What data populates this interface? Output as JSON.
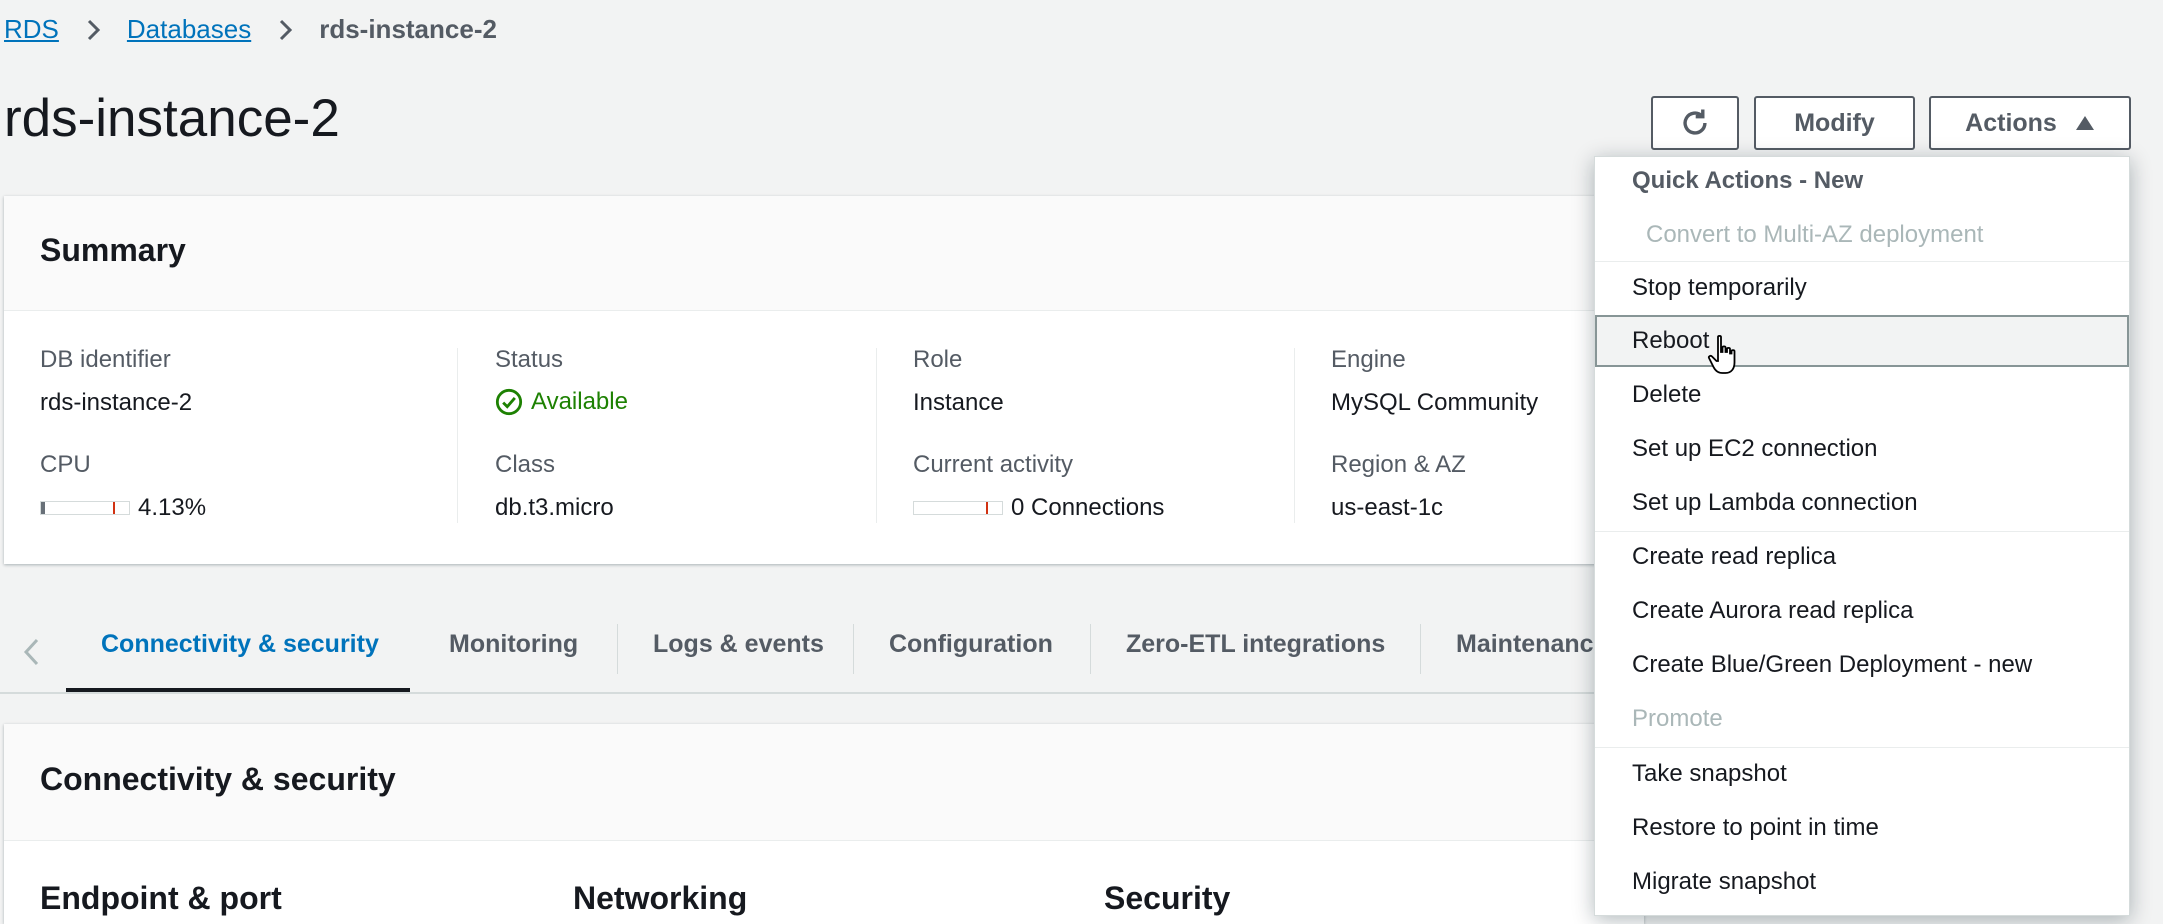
{
  "breadcrumb": {
    "items": [
      "RDS",
      "Databases"
    ],
    "current": "rds-instance-2"
  },
  "page": {
    "title": "rds-instance-2"
  },
  "header_buttons": {
    "refresh_icon": "refresh-icon",
    "modify": "Modify",
    "actions": "Actions"
  },
  "summary": {
    "title": "Summary",
    "db_identifier": {
      "label": "DB identifier",
      "value": "rds-instance-2"
    },
    "cpu": {
      "label": "CPU",
      "value": "4.13%",
      "fraction": 0.0413
    },
    "status": {
      "label": "Status",
      "value": "Available",
      "color": "#1d8102"
    },
    "class": {
      "label": "Class",
      "value": "db.t3.micro"
    },
    "role": {
      "label": "Role",
      "value": "Instance"
    },
    "current_activity": {
      "label": "Current activity",
      "value": "0 Connections"
    },
    "engine": {
      "label": "Engine",
      "value": "MySQL Community"
    },
    "region": {
      "label": "Region & AZ",
      "value": "us-east-1c"
    }
  },
  "tabs": [
    {
      "label": "Connectivity & security",
      "active": true
    },
    {
      "label": "Monitoring"
    },
    {
      "label": "Logs & events"
    },
    {
      "label": "Configuration"
    },
    {
      "label": "Zero-ETL integrations"
    },
    {
      "label": "Maintenanc"
    }
  ],
  "connectivity": {
    "title": "Connectivity & security",
    "sub_headers": [
      "Endpoint & port",
      "Networking",
      "Security"
    ]
  },
  "actions_menu": {
    "group_title": "Quick Actions - New",
    "items": [
      {
        "label": "Convert to Multi-AZ deployment",
        "disabled": true
      },
      {
        "label": "Stop temporarily"
      },
      {
        "label": "Reboot",
        "hovered": true
      },
      {
        "label": "Delete"
      },
      {
        "label": "Set up EC2 connection"
      },
      {
        "label": "Set up Lambda connection"
      },
      {
        "label": "Create read replica"
      },
      {
        "label": "Create Aurora read replica"
      },
      {
        "label": "Create Blue/Green Deployment - new"
      },
      {
        "label": "Promote",
        "disabled": true
      },
      {
        "label": "Take snapshot"
      },
      {
        "label": "Restore to point in time"
      },
      {
        "label": "Migrate snapshot"
      }
    ]
  },
  "colors": {
    "link": "#0073bb",
    "accent_tab": "#0073bb",
    "status_ok": "#1d8102",
    "threshold": "#d13212"
  }
}
